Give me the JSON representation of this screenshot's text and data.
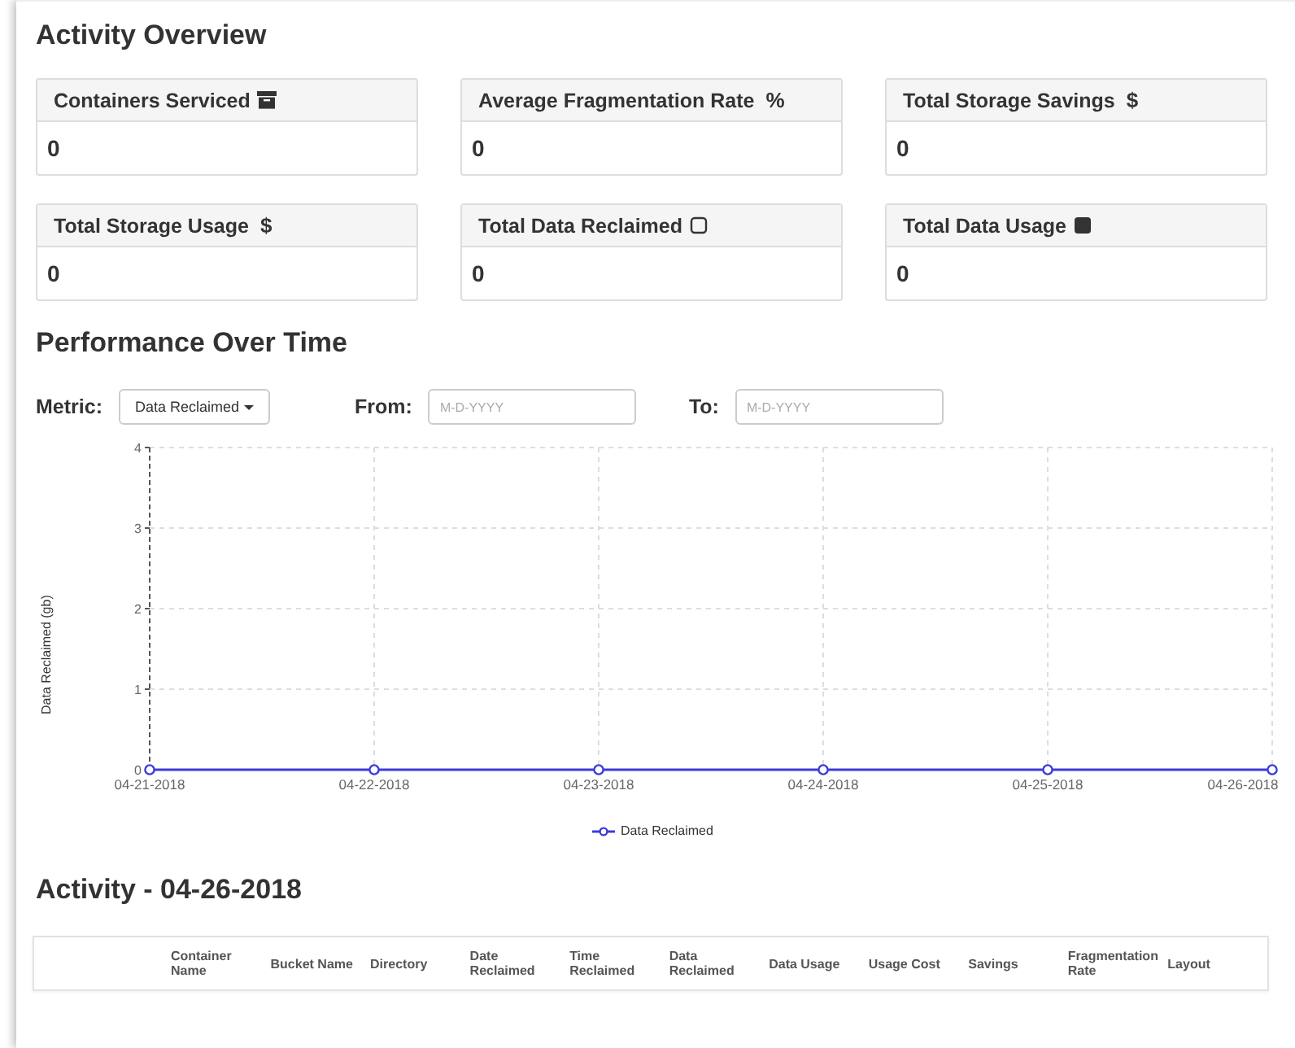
{
  "overview": {
    "title": "Activity Overview",
    "cards": [
      {
        "title": "Containers Serviced",
        "kind": "archive",
        "value": "0"
      },
      {
        "title": "Average Fragmentation Rate",
        "kind": "glyph",
        "glyph": "%",
        "value": "0"
      },
      {
        "title": "Total Storage Savings",
        "kind": "glyph",
        "glyph": "$",
        "value": "0"
      },
      {
        "title": "Total Storage Usage",
        "kind": "glyph",
        "glyph": "$",
        "value": "0"
      },
      {
        "title": "Total Data Reclaimed",
        "kind": "outline",
        "value": "0"
      },
      {
        "title": "Total Data Usage",
        "kind": "solid",
        "value": "0"
      }
    ]
  },
  "performance": {
    "title": "Performance Over Time",
    "metric": {
      "label": "Metric:",
      "value": "Data Reclaimed"
    },
    "from": {
      "label": "From:",
      "placeholder": "M-D-YYYY"
    },
    "to": {
      "label": "To:",
      "placeholder": "M-D-YYYY"
    },
    "chart_data": {
      "type": "line",
      "ylabel": "Data Reclaimed (gb)",
      "categories": [
        "04-21-2018",
        "04-22-2018",
        "04-23-2018",
        "04-24-2018",
        "04-25-2018",
        "04-26-2018"
      ],
      "series": [
        {
          "name": "Data Reclaimed",
          "color": "#3b3bdc",
          "marker": "circle",
          "values": [
            0,
            0,
            0,
            0,
            0,
            0
          ]
        }
      ],
      "ylim": [
        0,
        4
      ],
      "yticks": [
        {
          "value": 0,
          "label": "0"
        },
        {
          "value": 1,
          "label": "1"
        },
        {
          "value": 2,
          "label": "2"
        },
        {
          "value": 3,
          "label": "3"
        },
        {
          "value": 4,
          "label": "4"
        }
      ],
      "grid": true
    }
  },
  "activity": {
    "title": "Activity - 04-26-2018",
    "columns": [
      "Container Name",
      "Bucket Name",
      "Directory",
      "Date Reclaimed",
      "Time Reclaimed",
      "Data Reclaimed",
      "Data Usage",
      "Usage Cost",
      "Savings",
      "Fragmentation Rate",
      "Layout"
    ]
  }
}
